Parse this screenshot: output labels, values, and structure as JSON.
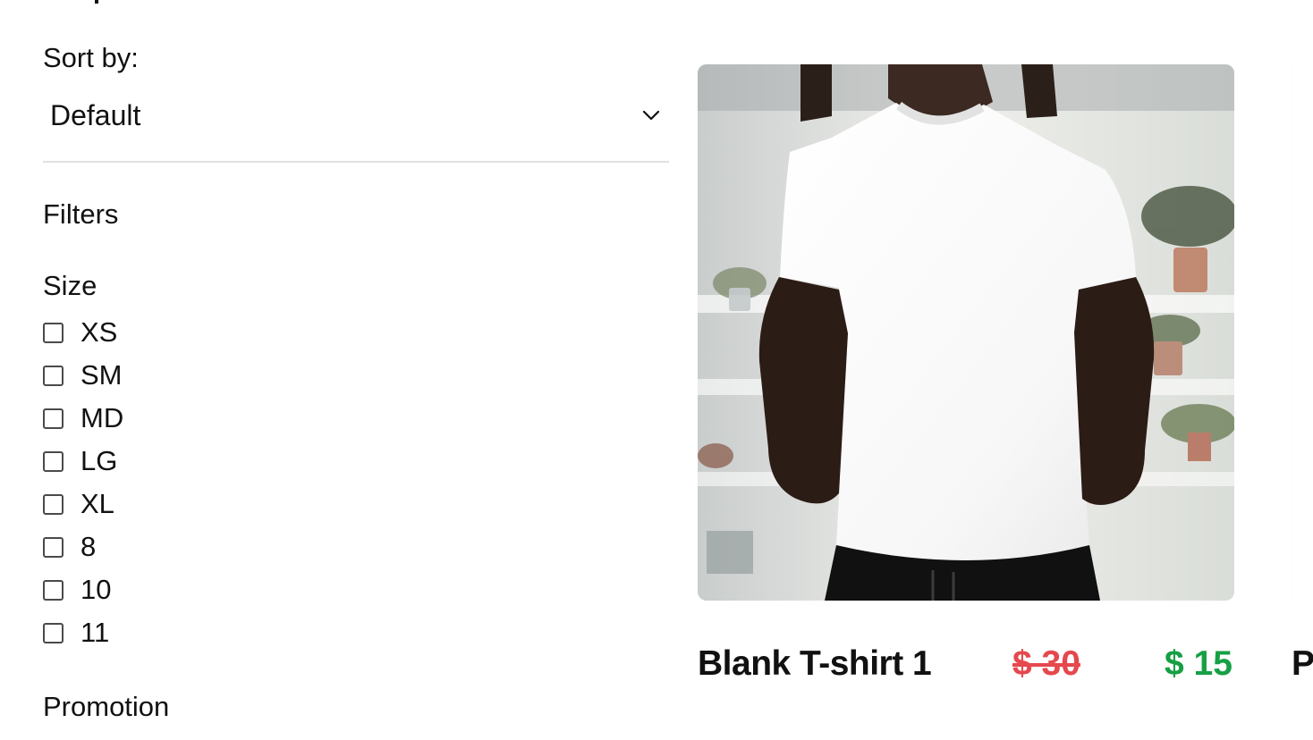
{
  "sidebar": {
    "sort_label": "Sort by:",
    "sort_value": "Default",
    "filters_title": "Filters",
    "size_title": "Size",
    "sizes": [
      "XS",
      "SM",
      "MD",
      "LG",
      "XL",
      "8",
      "10",
      "11"
    ],
    "promotion_title": "Promotion"
  },
  "products": [
    {
      "name": "Blank T-shirt 1",
      "old_price": "$ 30",
      "new_price": "$ 15",
      "image": "white-tshirt-photo"
    }
  ],
  "next_product": {
    "title_fragment": "P"
  },
  "icons": {
    "sort_chevron": "chevron-down-icon",
    "checkbox": "checkbox-icon"
  },
  "colors": {
    "old_price": "#e5484d",
    "new_price": "#169f45",
    "divider": "#e1e1e1"
  }
}
